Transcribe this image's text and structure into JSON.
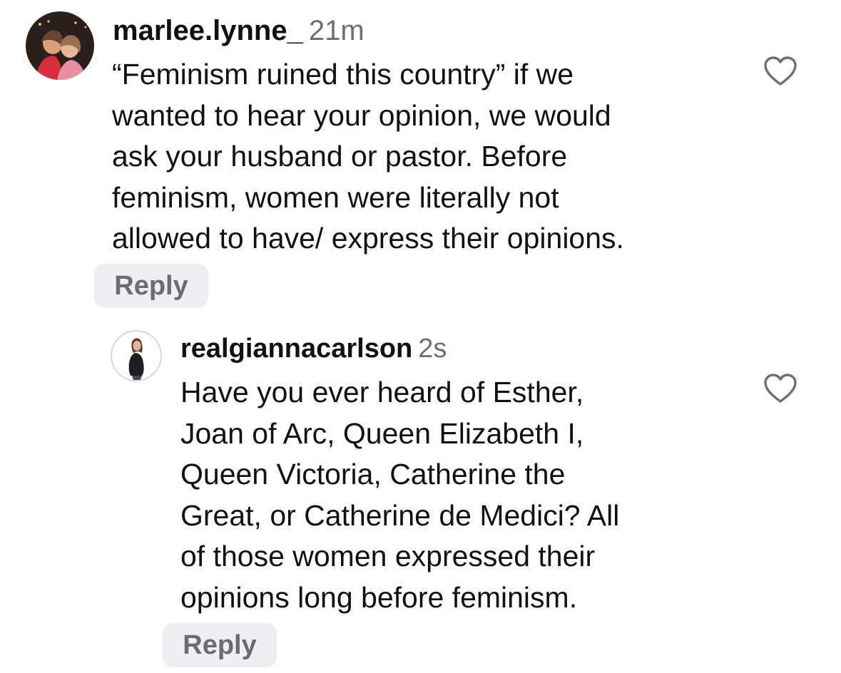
{
  "comments": [
    {
      "username": "marlee.lynne_",
      "time": "21m",
      "text": "“Feminism ruined this country” if we\nwanted to hear your opinion, we would\nask your husband or pastor. Before\nfeminism, women were literally not\nallowed to have/ express their opinions.",
      "reply_label": "Reply",
      "like_icon": "heart-outline-icon"
    },
    {
      "username": "realgiannacarlson",
      "time": "2s",
      "text": "Have you ever heard of Esther,\nJoan of Arc, Queen Elizabeth I,\nQueen Victoria, Catherine the\nGreat, or Catherine de Medici? All\nof those women expressed their\nopinions long before feminism.",
      "reply_label": "Reply",
      "like_icon": "heart-outline-icon"
    }
  ],
  "colors": {
    "text": "#111111",
    "meta": "#6e6e73",
    "reply_bg": "#efeff1",
    "reply_text": "#6b6b70",
    "heart_stroke": "#6b7078"
  }
}
